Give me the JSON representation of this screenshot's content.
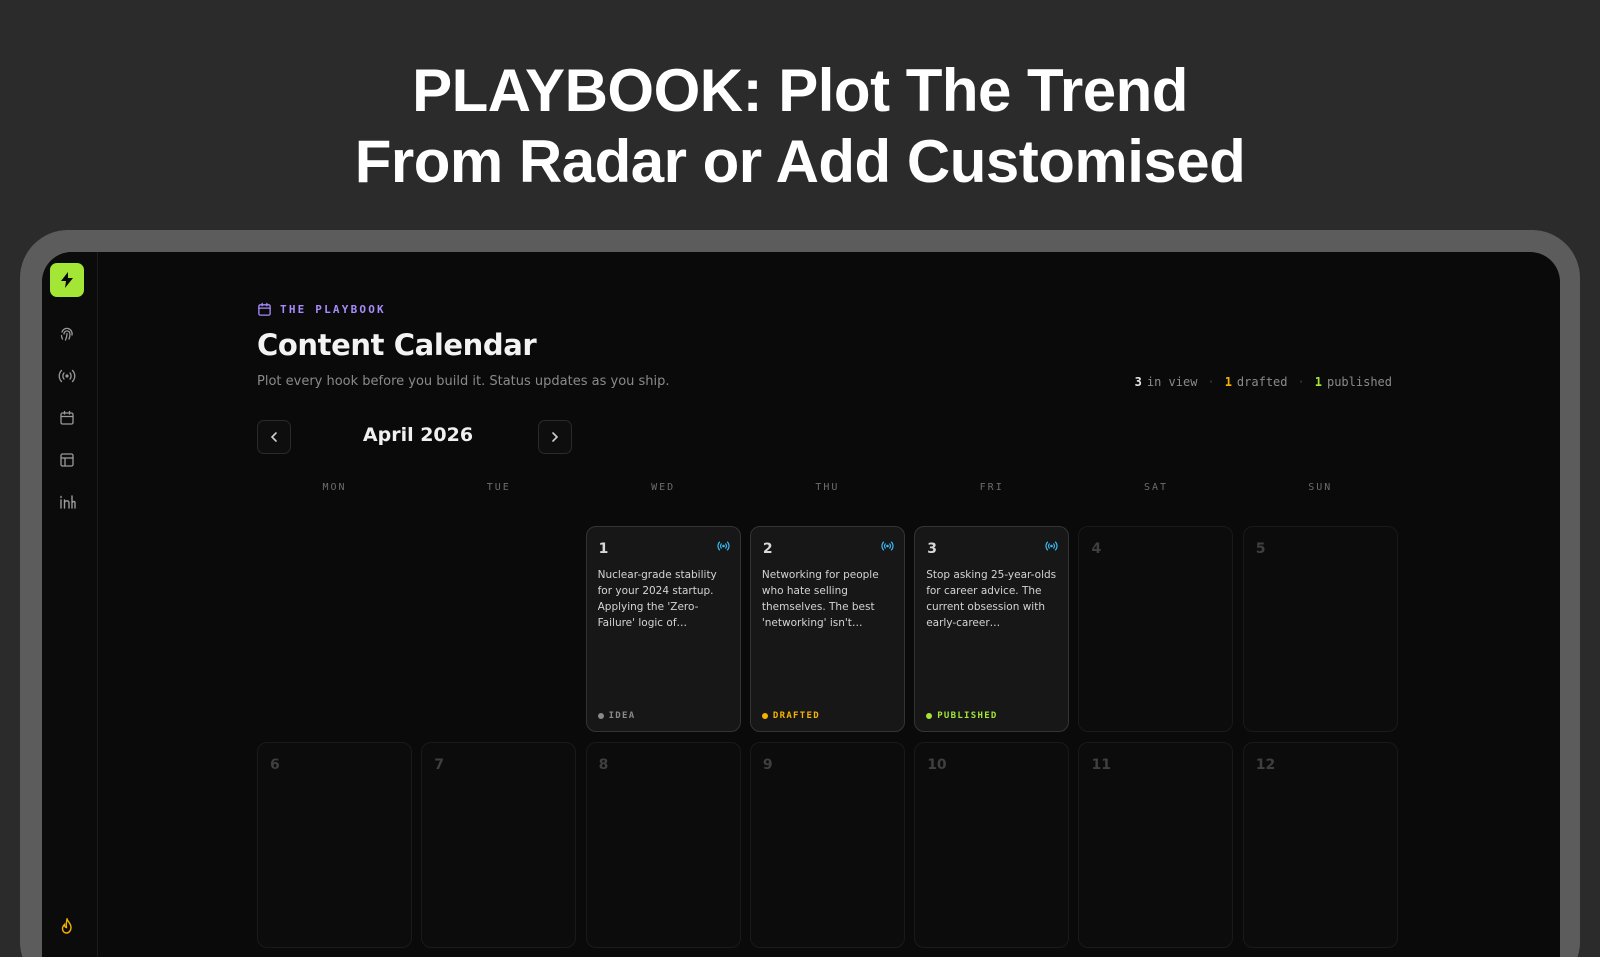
{
  "headline": {
    "line1": "PLAYBOOK: Plot The Trend",
    "line2": "From Radar or Add Customised"
  },
  "sidebar": {
    "logo": "bolt-icon",
    "items": [
      {
        "icon": "fingerprint-icon"
      },
      {
        "icon": "radar-icon"
      },
      {
        "icon": "calendar-icon"
      },
      {
        "icon": "layout-icon"
      },
      {
        "icon": "linkedin-icon"
      }
    ],
    "footer_icon": "flame-icon"
  },
  "header": {
    "eyebrow": "THE PLAYBOOK",
    "title": "Content Calendar",
    "subtitle": "Plot every hook before you build it. Status updates as you ship."
  },
  "stats": {
    "in_view_count": "3",
    "in_view_label": "in view",
    "drafted_count": "1",
    "drafted_label": "drafted",
    "published_count": "1",
    "published_label": "published"
  },
  "calendar": {
    "month": "April 2026",
    "weekdays": [
      "MON",
      "TUE",
      "WED",
      "THU",
      "FRI",
      "SAT",
      "SUN"
    ],
    "days": [
      {
        "day": "1",
        "text": "Nuclear-grade stability for your 2024 startup. Applying the 'Zero-Failure' logic of Nuclear…",
        "status": "IDEA"
      },
      {
        "day": "2",
        "text": "Networking for people who hate selling themselves. The best 'networking' isn't talkin…",
        "status": "DRAFTED"
      },
      {
        "day": "3",
        "text": "Stop asking 25-year-olds for career advice. The current obsession with early-career…",
        "status": "PUBLISHED"
      },
      {
        "day": "4"
      },
      {
        "day": "5"
      },
      {
        "day": "6"
      },
      {
        "day": "7"
      },
      {
        "day": "8"
      },
      {
        "day": "9"
      },
      {
        "day": "10"
      },
      {
        "day": "11"
      },
      {
        "day": "12"
      }
    ]
  },
  "colors": {
    "accent": "#a3e635",
    "eyebrow": "#a78bfa",
    "idea": "#8a8a8a",
    "drafted": "#f5b301",
    "published": "#a3e635",
    "radar": "#38bdf8"
  }
}
